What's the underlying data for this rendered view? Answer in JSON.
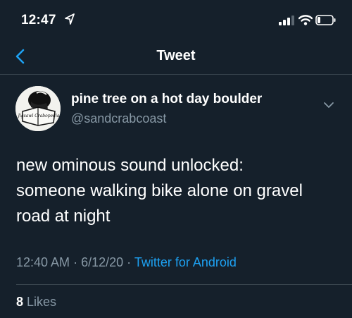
{
  "status_bar": {
    "time": "12:47"
  },
  "nav": {
    "title": "Tweet"
  },
  "tweet": {
    "author_name": "pine tree on a hot day boulder",
    "handle": "@sandcrabcoast",
    "avatar_text": "Jigsawl Crabopedia",
    "text_lines": [
      "new ominous sound unlocked:",
      "someone walking bike alone on gravel",
      "road at night"
    ],
    "time": "12:40 AM",
    "date": "6/12/20",
    "separator": "·",
    "source": "Twitter for Android",
    "likes_count": "8",
    "likes_label": "Likes"
  },
  "colors": {
    "background": "#15202b",
    "accent": "#1da1f2",
    "secondary_text": "#8899a6",
    "divider": "#38444d"
  }
}
